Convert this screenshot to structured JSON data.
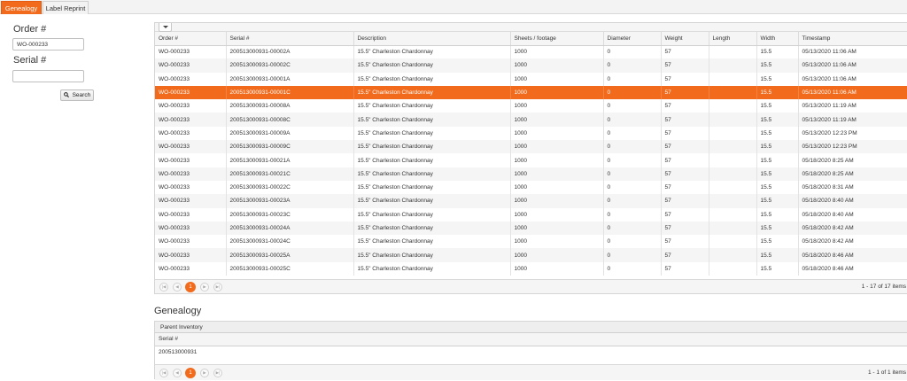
{
  "tabs": [
    {
      "label": "Genealogy",
      "active": true
    },
    {
      "label": "Label Reprint",
      "active": false
    }
  ],
  "search": {
    "order_label": "Order #",
    "order_value": "WO-000233",
    "serial_label": "Serial #",
    "serial_value": "",
    "button_label": "Search"
  },
  "grid": {
    "columns": [
      "Order #",
      "Serial #",
      "Description",
      "Sheets / footage",
      "Diameter",
      "Weight",
      "Length",
      "Width",
      "Timestamp"
    ],
    "selected_index": 3,
    "rows": [
      [
        "WO-000233",
        "200513000931-00002A",
        "15.5\" Charleston Chardonnay",
        "1000",
        "0",
        "57",
        "",
        "15.5",
        "05/13/2020 11:06 AM"
      ],
      [
        "WO-000233",
        "200513000931-00002C",
        "15.5\" Charleston Chardonnay",
        "1000",
        "0",
        "57",
        "",
        "15.5",
        "05/13/2020 11:06 AM"
      ],
      [
        "WO-000233",
        "200513000931-00001A",
        "15.5\" Charleston Chardonnay",
        "1000",
        "0",
        "57",
        "",
        "15.5",
        "05/13/2020 11:06 AM"
      ],
      [
        "WO-000233",
        "200513000931-00001C",
        "15.5\" Charleston Chardonnay",
        "1000",
        "0",
        "57",
        "",
        "15.5",
        "05/13/2020 11:06 AM"
      ],
      [
        "WO-000233",
        "200513000931-00008A",
        "15.5\" Charleston Chardonnay",
        "1000",
        "0",
        "57",
        "",
        "15.5",
        "05/13/2020 11:19 AM"
      ],
      [
        "WO-000233",
        "200513000931-00008C",
        "15.5\" Charleston Chardonnay",
        "1000",
        "0",
        "57",
        "",
        "15.5",
        "05/13/2020 11:19 AM"
      ],
      [
        "WO-000233",
        "200513000931-00009A",
        "15.5\" Charleston Chardonnay",
        "1000",
        "0",
        "57",
        "",
        "15.5",
        "05/13/2020 12:23 PM"
      ],
      [
        "WO-000233",
        "200513000931-00009C",
        "15.5\" Charleston Chardonnay",
        "1000",
        "0",
        "57",
        "",
        "15.5",
        "05/13/2020 12:23 PM"
      ],
      [
        "WO-000233",
        "200513000931-00021A",
        "15.5\" Charleston Chardonnay",
        "1000",
        "0",
        "57",
        "",
        "15.5",
        "05/18/2020 8:25 AM"
      ],
      [
        "WO-000233",
        "200513000931-00021C",
        "15.5\" Charleston Chardonnay",
        "1000",
        "0",
        "57",
        "",
        "15.5",
        "05/18/2020 8:25 AM"
      ],
      [
        "WO-000233",
        "200513000931-00022C",
        "15.5\" Charleston Chardonnay",
        "1000",
        "0",
        "57",
        "",
        "15.5",
        "05/18/2020 8:31 AM"
      ],
      [
        "WO-000233",
        "200513000931-00023A",
        "15.5\" Charleston Chardonnay",
        "1000",
        "0",
        "57",
        "",
        "15.5",
        "05/18/2020 8:40 AM"
      ],
      [
        "WO-000233",
        "200513000931-00023C",
        "15.5\" Charleston Chardonnay",
        "1000",
        "0",
        "57",
        "",
        "15.5",
        "05/18/2020 8:40 AM"
      ],
      [
        "WO-000233",
        "200513000931-00024A",
        "15.5\" Charleston Chardonnay",
        "1000",
        "0",
        "57",
        "",
        "15.5",
        "05/18/2020 8:42 AM"
      ],
      [
        "WO-000233",
        "200513000931-00024C",
        "15.5\" Charleston Chardonnay",
        "1000",
        "0",
        "57",
        "",
        "15.5",
        "05/18/2020 8:42 AM"
      ],
      [
        "WO-000233",
        "200513000931-00025A",
        "15.5\" Charleston Chardonnay",
        "1000",
        "0",
        "57",
        "",
        "15.5",
        "05/18/2020 8:46 AM"
      ],
      [
        "WO-000233",
        "200513000931-00025C",
        "15.5\" Charleston Chardonnay",
        "1000",
        "0",
        "57",
        "",
        "15.5",
        "05/18/2020 8:46 AM"
      ]
    ],
    "pager": {
      "current_page": "1",
      "info": "1 - 17 of 17 items"
    }
  },
  "genealogy": {
    "title": "Genealogy",
    "panel_title": "Parent Inventory",
    "columns": [
      "Serial #"
    ],
    "rows": [
      [
        "200513000931"
      ]
    ],
    "pager": {
      "current_page": "1",
      "info": "1 - 1 of 1 items"
    }
  },
  "colors": {
    "accent": "#f26a1b",
    "header_bg": "#f5f5f5",
    "alt_row": "#f5f5f5"
  },
  "icons": {
    "search": "search-icon",
    "menu": "chevron-down-icon",
    "first": "first-page-icon",
    "prev": "prev-page-icon",
    "next": "next-page-icon",
    "last": "last-page-icon"
  }
}
